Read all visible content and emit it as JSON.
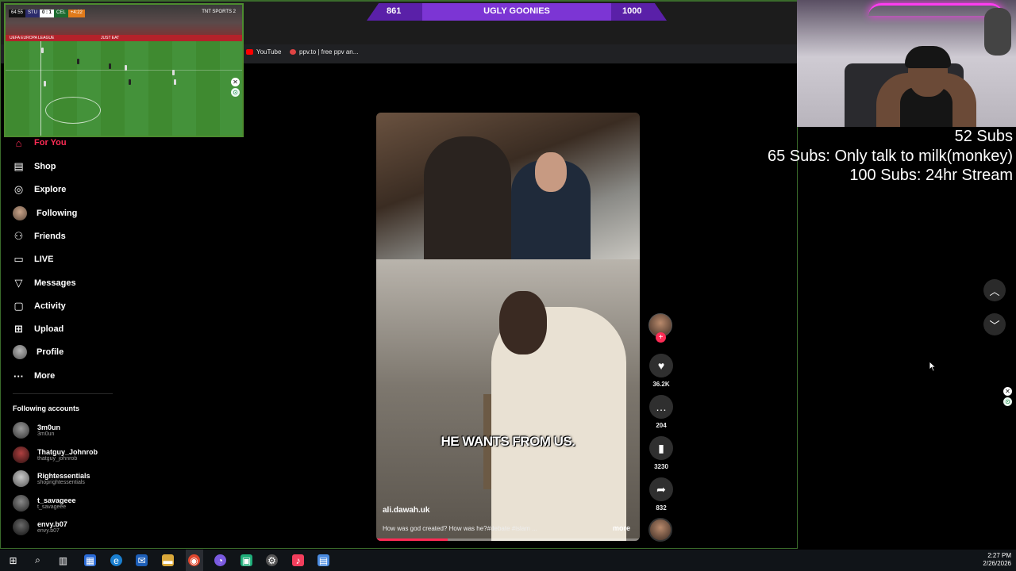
{
  "scoreboard": {
    "left_score": "861",
    "team": "UGLY GOONIES",
    "right_score": "1000"
  },
  "sports_stream": {
    "hud_time": "64:55",
    "hud_team_left": "STU",
    "hud_score": "0 : 1",
    "hud_team_right": "CEL",
    "hud_extra": "+4:22",
    "channel": "TNT SPORTS 2",
    "ad_text": "JUST EAT",
    "league": "UEFA EUROPA LEAGUE"
  },
  "bookmarks": [
    {
      "label": "YouTube",
      "color": "#ff0000"
    },
    {
      "label": "ppv.to | free ppv an...",
      "color": "#e04444"
    }
  ],
  "sidebar": {
    "nav": [
      {
        "label": "For You",
        "icon": "home-icon",
        "active": true
      },
      {
        "label": "Shop",
        "icon": "shopping-bag-icon"
      },
      {
        "label": "Explore",
        "icon": "compass-icon"
      },
      {
        "label": "Following",
        "icon": "avatar-icon"
      },
      {
        "label": "Friends",
        "icon": "friends-icon"
      },
      {
        "label": "LIVE",
        "icon": "live-icon"
      },
      {
        "label": "Messages",
        "icon": "send-icon"
      },
      {
        "label": "Activity",
        "icon": "activity-icon"
      },
      {
        "label": "Upload",
        "icon": "upload-icon"
      },
      {
        "label": "Profile",
        "icon": "profile-avatar-icon"
      },
      {
        "label": "More",
        "icon": "more-icon"
      }
    ],
    "following_title": "Following accounts",
    "accounts": [
      {
        "name": "3m0un",
        "handle": "3m0un",
        "color": "#6b6b6b"
      },
      {
        "name": "Thatguy_Johnrob",
        "handle": "thatguy_johnrob",
        "color": "#7a2020"
      },
      {
        "name": "Rightessentials",
        "handle": "shoprightessentials",
        "color": "#8a8a8a"
      },
      {
        "name": "t_savageee",
        "handle": "t_savageee",
        "color": "#5a5a5a"
      },
      {
        "name": "envy.b07",
        "handle": "envy.b07",
        "color": "#3a3a3a"
      }
    ]
  },
  "video": {
    "caption": "HE WANTS FROM US.",
    "author": "ali.dawah.uk",
    "description": "How was god created? How was he?#debate #islam ...",
    "more_label": "more",
    "progress": 0.27
  },
  "actions": {
    "likes": "36.2K",
    "comments": "204",
    "saves": "3230",
    "shares": "832"
  },
  "subs_goals": [
    "52 Subs",
    "65 Subs: Only talk to milk(monkey)",
    "100 Subs: 24hr Stream"
  ],
  "clock": {
    "time": "2:27 PM",
    "date": "2/26/2026"
  },
  "colors": {
    "accent": "#fe2c55",
    "scorebar": "#7c35d4",
    "frame": "#3a6b2b"
  }
}
